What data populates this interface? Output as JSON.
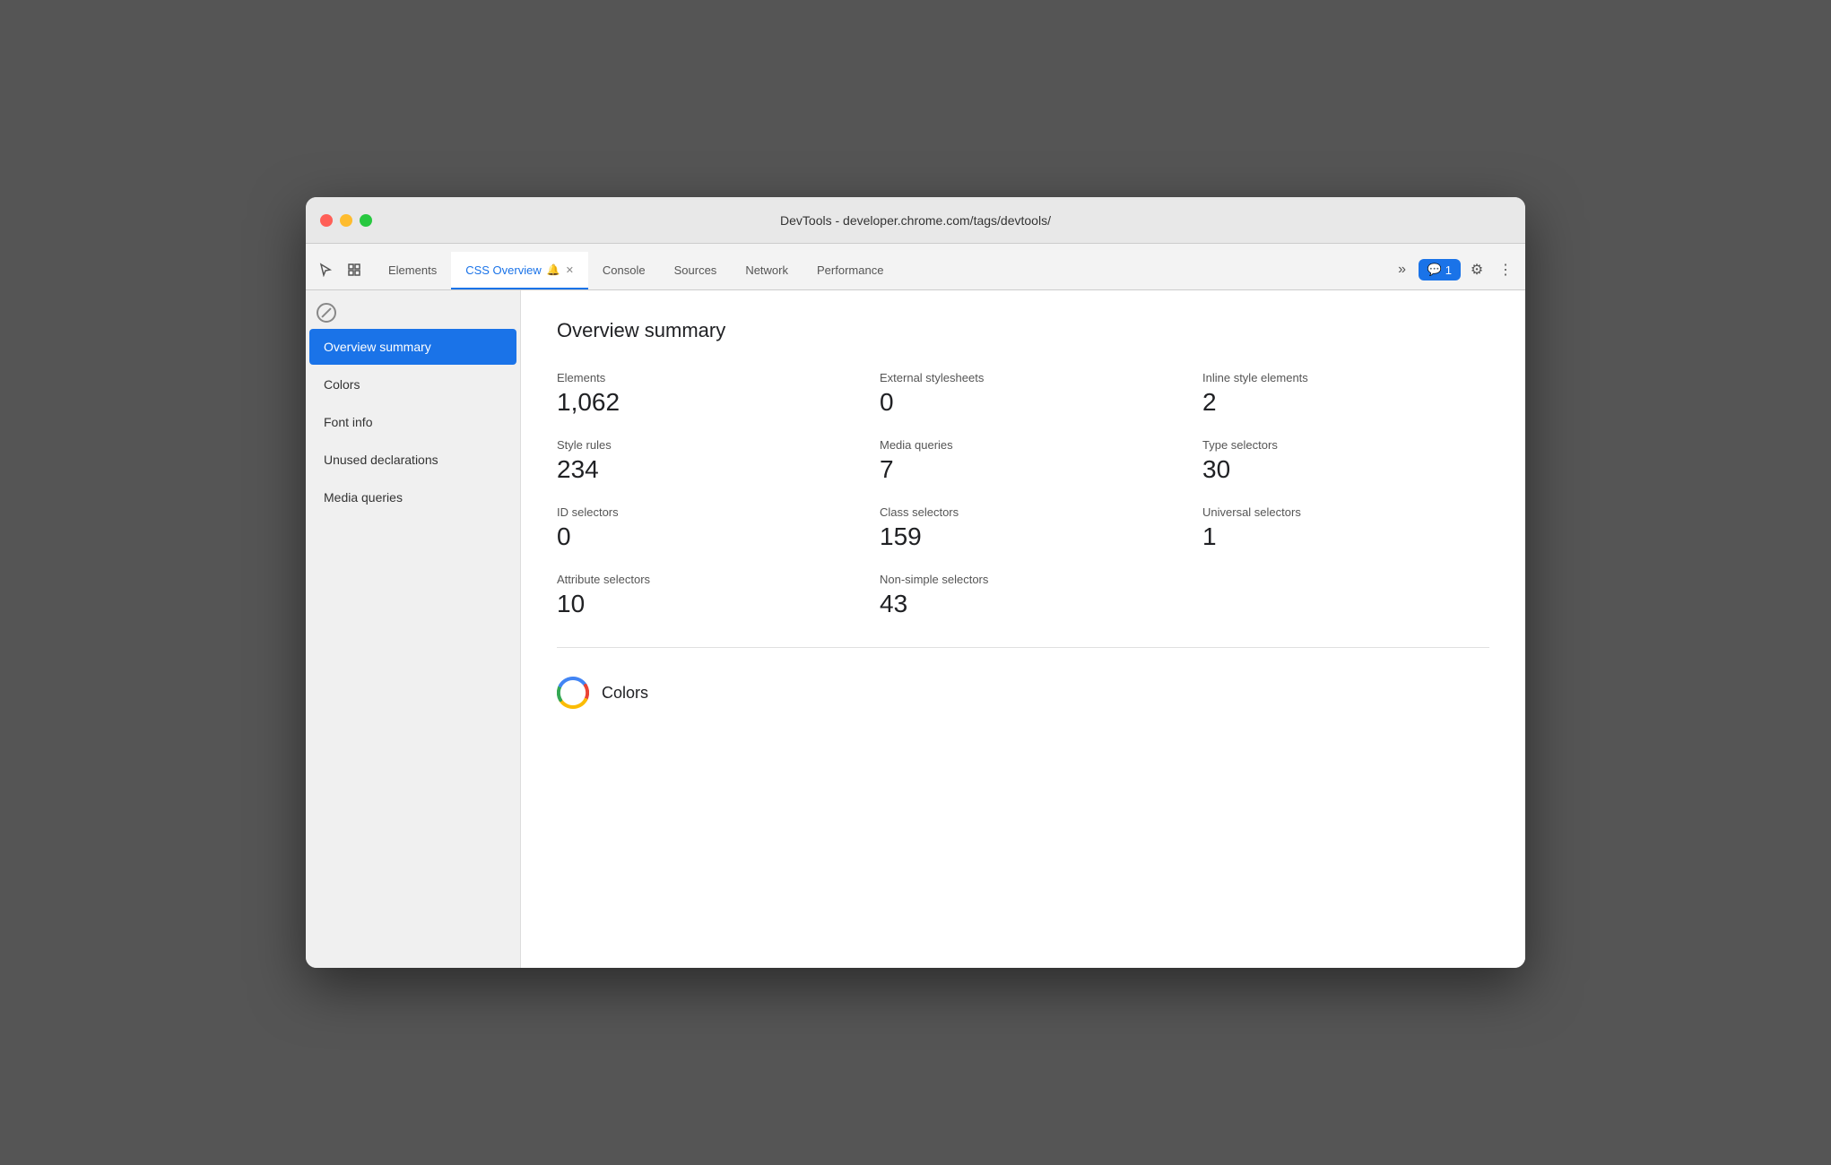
{
  "window": {
    "title": "DevTools - developer.chrome.com/tags/devtools/"
  },
  "tabs": [
    {
      "id": "elements",
      "label": "Elements",
      "active": false
    },
    {
      "id": "css-overview",
      "label": "CSS Overview",
      "active": true,
      "has_bell": true,
      "closeable": true
    },
    {
      "id": "console",
      "label": "Console",
      "active": false
    },
    {
      "id": "sources",
      "label": "Sources",
      "active": false
    },
    {
      "id": "network",
      "label": "Network",
      "active": false
    },
    {
      "id": "performance",
      "label": "Performance",
      "active": false
    }
  ],
  "toolbar": {
    "more_label": "»",
    "notification_label": "1",
    "notification_icon": "💬"
  },
  "sidebar": {
    "items": [
      {
        "id": "overview-summary",
        "label": "Overview summary",
        "active": true
      },
      {
        "id": "colors",
        "label": "Colors",
        "active": false
      },
      {
        "id": "font-info",
        "label": "Font info",
        "active": false
      },
      {
        "id": "unused-declarations",
        "label": "Unused declarations",
        "active": false
      },
      {
        "id": "media-queries",
        "label": "Media queries",
        "active": false
      }
    ]
  },
  "main": {
    "section_title": "Overview summary",
    "stats": [
      {
        "id": "elements",
        "label": "Elements",
        "value": "1,062"
      },
      {
        "id": "external-stylesheets",
        "label": "External stylesheets",
        "value": "0"
      },
      {
        "id": "inline-style-elements",
        "label": "Inline style elements",
        "value": "2"
      },
      {
        "id": "style-rules",
        "label": "Style rules",
        "value": "234"
      },
      {
        "id": "media-queries",
        "label": "Media queries",
        "value": "7"
      },
      {
        "id": "type-selectors",
        "label": "Type selectors",
        "value": "30"
      },
      {
        "id": "id-selectors",
        "label": "ID selectors",
        "value": "0"
      },
      {
        "id": "class-selectors",
        "label": "Class selectors",
        "value": "159"
      },
      {
        "id": "universal-selectors",
        "label": "Universal selectors",
        "value": "1"
      },
      {
        "id": "attribute-selectors",
        "label": "Attribute selectors",
        "value": "10"
      },
      {
        "id": "non-simple-selectors",
        "label": "Non-simple selectors",
        "value": "43"
      }
    ],
    "colors_section_label": "Colors"
  }
}
